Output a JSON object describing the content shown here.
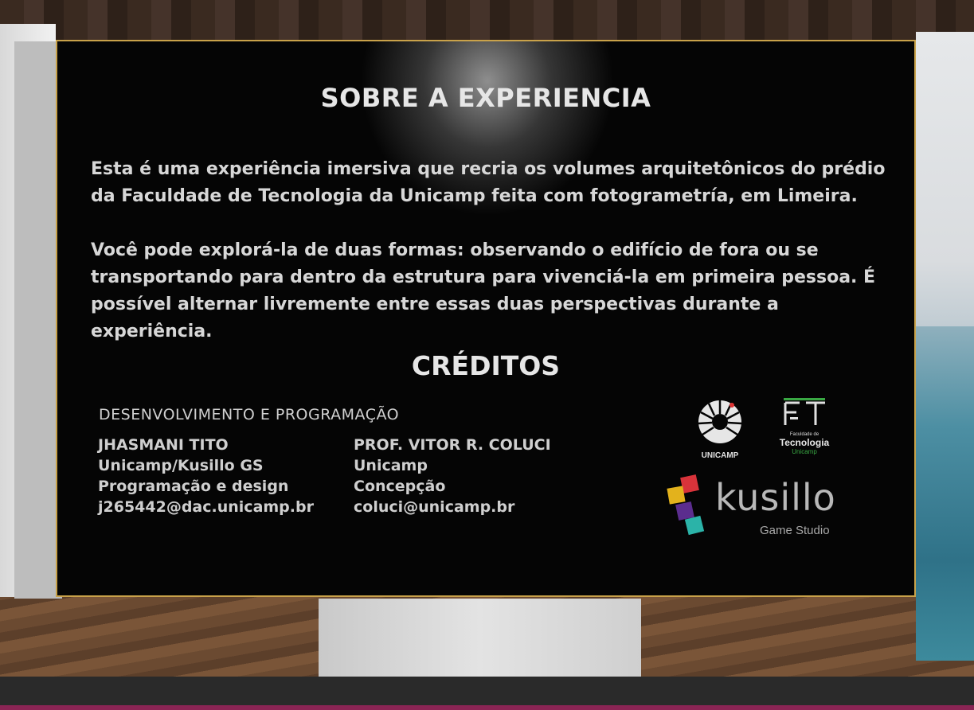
{
  "panel": {
    "title": "SOBRE A EXPERIENCIA",
    "paragraph_1": "Esta é uma experiência imersiva que recria os volumes arquitetônicos do prédio da Faculdade de Tecnologia da Unicamp feita com fotogrametría, em Limeira.",
    "paragraph_2": "Você pode explorá-la de duas formas: observando o edifício de fora ou se transportando para dentro da estrutura para vivenciá-la em primeira pessoa. É possível alternar livremente entre essas duas perspectivas durante a experiência.",
    "credits_title": "CRÉDITOS",
    "section_heading": "DESENVOLVIMENTO E PROGRAMAÇÃO",
    "people": [
      {
        "name": "JHASMANI TITO",
        "affiliation": "Unicamp/Kusillo GS",
        "role": "Programação e design",
        "email": "j265442@dac.unicamp.br"
      },
      {
        "name": "PROF. VITOR R. COLUCI",
        "affiliation": "Unicamp",
        "role": "Concepção",
        "email": "coluci@unicamp.br"
      }
    ]
  },
  "logos": {
    "unicamp": "UNICAMP",
    "ft_small": "Faculdade de",
    "ft_big": "Tecnologia",
    "ft_uni": "Unicamp",
    "kusillo_word": "kusillo",
    "kusillo_sub": "Game Studio"
  },
  "colors": {
    "panel_bg": "#050505",
    "panel_border": "#c9a24a",
    "text": "#d7d7d7",
    "ft_green": "#39a843",
    "kusillo_red": "#d8333a",
    "kusillo_yellow": "#e3b21c",
    "kusillo_purple": "#5b2d8e",
    "kusillo_teal": "#2bb3a8"
  }
}
